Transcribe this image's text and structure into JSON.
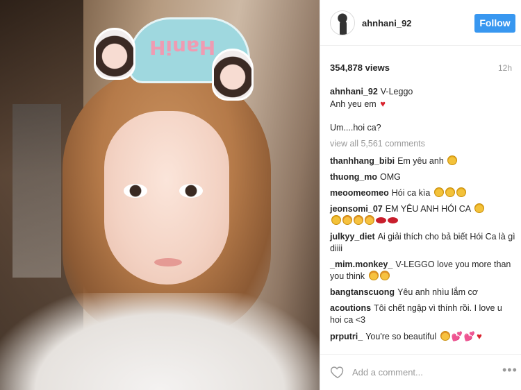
{
  "post": {
    "username": "ahnhani_92",
    "follow_label": "Follow",
    "views": "354,878 views",
    "time": "12h",
    "photo_headband_text": "HaniH"
  },
  "caption": {
    "user": "ahnhani_92",
    "line1": "V-Leggo",
    "line2": "Anh yeu em",
    "line2_icon": "heart-icon",
    "line3": "Um....hoi ca?"
  },
  "view_all": "view all 5,561 comments",
  "comments": [
    {
      "user": "thanhhang_bibi",
      "text": "Em yêu anh"
    },
    {
      "user": "thuong_mo",
      "text": "OMG"
    },
    {
      "user": "meoomeomeo",
      "text": "Hói ca kìa"
    },
    {
      "user": "jeonsomi_07",
      "text": "EM YÊU ANH HÓI CA"
    },
    {
      "user": "julkyy_diet",
      "text": "Ai giải thích cho bả biết Hói Ca là gì diiii"
    },
    {
      "user": "_mim.monkey_",
      "text": "V-LEGGO love you more than you think"
    },
    {
      "user": "bangtanscuong",
      "text": "Yêu anh nhìu lắm cơ"
    },
    {
      "user": "acoutions",
      "text": "Tôi chết ngập vì thính rồi. I love u hoi ca <3"
    },
    {
      "user": "prputri_",
      "text": "You're so beautiful"
    }
  ],
  "footer": {
    "add_comment_placeholder": "Add a comment...",
    "more_label": "•••"
  },
  "colors": {
    "accent": "#3897f0",
    "text": "#262626",
    "muted": "#999999"
  }
}
